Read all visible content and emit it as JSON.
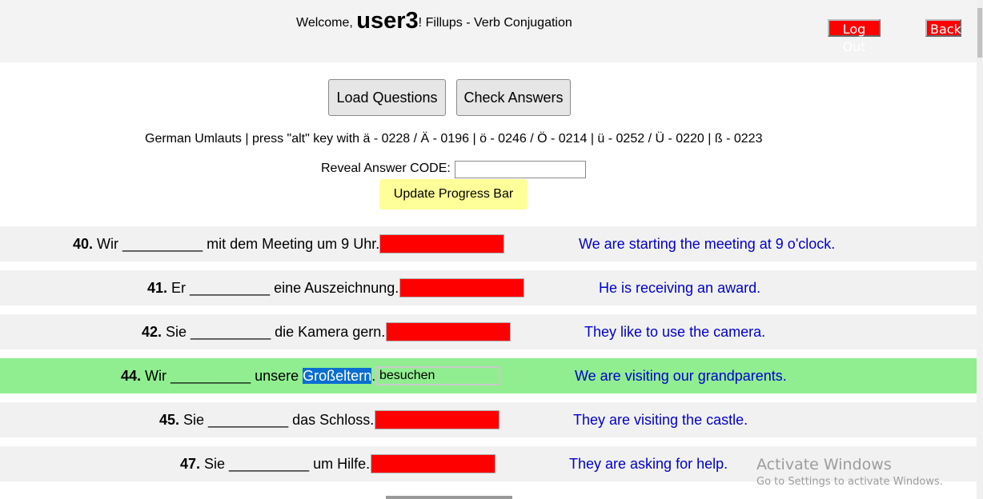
{
  "header": {
    "welcome_prefix": "Welcome, ",
    "username": "user3",
    "suffix": "! Fillups - Verb Conjugation",
    "logout_label": "Log Out",
    "back_label": "Back"
  },
  "controls": {
    "load_label": "Load Questions",
    "check_label": "Check Answers",
    "umlauts_text": "German Umlauts | press \"alt\" key with ä - 0228 / Ä - 0196 | ö - 0246 / Ö - 0214 | ü - 0252 / Ü - 0220 | ß - 0223",
    "reveal_label": "Reveal Answer CODE:",
    "reveal_value": "",
    "progress_label": "Update Progress Bar"
  },
  "questions": [
    {
      "num": "40.",
      "before": " Wir __________ mit dem Meeting um 9 Uhr.",
      "highlight": "",
      "after": "",
      "answer": "",
      "translation": "We are starting the meeting at 9 o'clock."
    },
    {
      "num": "41.",
      "before": " Er __________ eine Auszeichnung.",
      "highlight": "",
      "after": "",
      "answer": "",
      "translation": "He is receiving an award."
    },
    {
      "num": "42.",
      "before": " Sie __________ die Kamera gern.",
      "highlight": "",
      "after": "",
      "answer": "",
      "translation": "They like to use the camera."
    },
    {
      "num": "44.",
      "before": " Wir __________ unsere ",
      "highlight": "Großeltern",
      "after": ".",
      "answer": "besuchen",
      "translation": "We are visiting our grandparents."
    },
    {
      "num": "45.",
      "before": " Sie __________ das Schloss.",
      "highlight": "",
      "after": "",
      "answer": "",
      "translation": "They are visiting the castle."
    },
    {
      "num": "47.",
      "before": " Sie __________ um Hilfe.",
      "highlight": "",
      "after": "",
      "answer": "",
      "translation": "They are asking for help."
    }
  ],
  "watermark": {
    "line1": "Activate Windows",
    "line2": "Go to Settings to activate Windows."
  },
  "colors": {
    "wrong": "#ff0000",
    "correct": "#90ee90",
    "translation": "#0000cd",
    "progress_button": "#ffff99"
  }
}
